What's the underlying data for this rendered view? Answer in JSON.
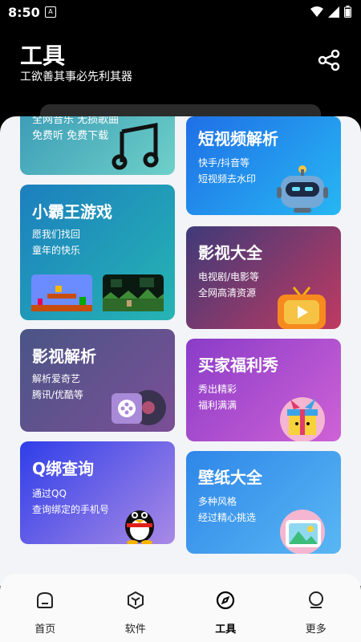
{
  "status": {
    "time": "8:50",
    "notif": "A"
  },
  "header": {
    "title": "工具",
    "subtitle": "工欲善其事必先利其器"
  },
  "cards": {
    "music": {
      "line1": "全网音乐 无损歌曲",
      "line2": "免费听 免费下载"
    },
    "short_video": {
      "title": "短视频解析",
      "line1": "快手/抖音等",
      "line2": "短视频去水印"
    },
    "game": {
      "title": "小霸王游戏",
      "line1": "愿我们找回",
      "line2": "童年的快乐"
    },
    "movies": {
      "title": "影视大全",
      "line1": "电视剧/电影等",
      "line2": "全网高清资源"
    },
    "video_parse": {
      "title": "影视解析",
      "line1": "解析爱奇艺",
      "line2": "腾讯/优酷等"
    },
    "welfare": {
      "title": "买家福利秀",
      "line1": "秀出精彩",
      "line2": "福利满满"
    },
    "qq": {
      "title": "Q绑查询",
      "line1": "通过QQ",
      "line2": "查询绑定的手机号"
    },
    "wallpaper": {
      "title": "壁纸大全",
      "line1": "多种风格",
      "line2": "经过精心挑选"
    }
  },
  "nav": [
    {
      "label": "首页",
      "icon": "home-icon"
    },
    {
      "label": "软件",
      "icon": "box-icon"
    },
    {
      "label": "工具",
      "icon": "compass-icon",
      "active": true
    },
    {
      "label": "更多",
      "icon": "more-icon"
    }
  ]
}
